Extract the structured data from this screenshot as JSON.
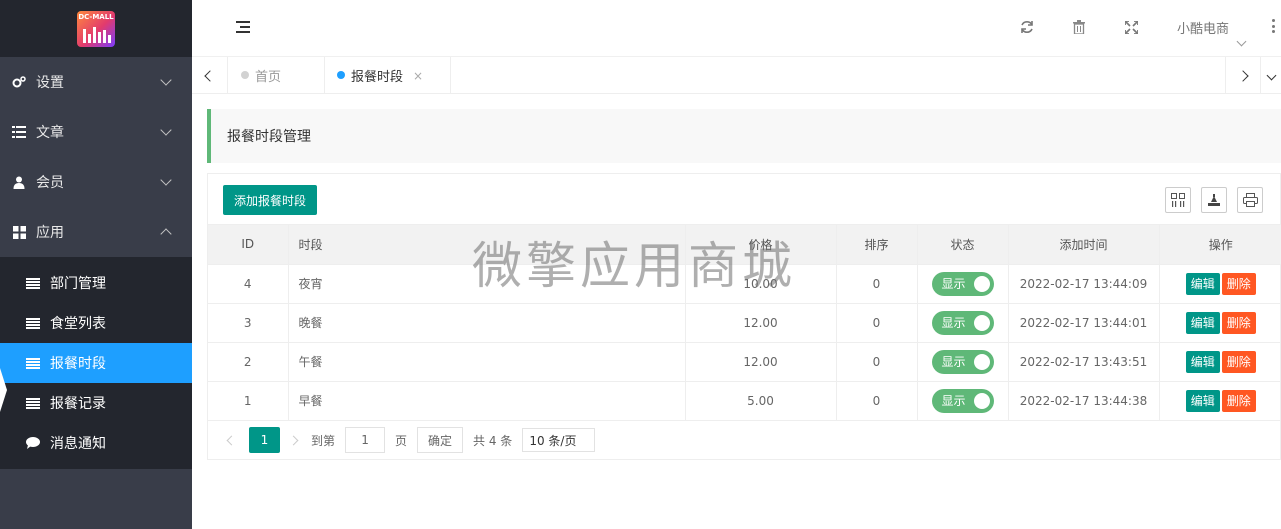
{
  "logo": {
    "text": "DC-MALL"
  },
  "sidebar": {
    "menus": [
      {
        "label": "设置",
        "icon": "gears-icon",
        "expanded": false
      },
      {
        "label": "文章",
        "icon": "list-icon",
        "expanded": false
      },
      {
        "label": "会员",
        "icon": "user-icon",
        "expanded": false
      },
      {
        "label": "应用",
        "icon": "grid-icon",
        "expanded": true
      }
    ],
    "submenu": [
      {
        "label": "部门管理",
        "icon": "list-icon",
        "active": false
      },
      {
        "label": "食堂列表",
        "icon": "list-icon",
        "active": false
      },
      {
        "label": "报餐时段",
        "icon": "list-icon",
        "active": true
      },
      {
        "label": "报餐记录",
        "icon": "list-icon",
        "active": false
      },
      {
        "label": "消息通知",
        "icon": "chat-icon",
        "active": false
      }
    ]
  },
  "header": {
    "user": "小酷电商",
    "icons": [
      "refresh-icon",
      "trash-icon",
      "fullscreen-icon",
      "more-icon"
    ]
  },
  "tabs": [
    {
      "label": "首页",
      "active": false
    },
    {
      "label": "报餐时段",
      "active": true,
      "close": "×"
    }
  ],
  "page": {
    "title": "报餐时段管理"
  },
  "toolbar": {
    "add_label": "添加报餐时段"
  },
  "table": {
    "columns": [
      "ID",
      "时段",
      "价格",
      "排序",
      "状态",
      "添加时间",
      "操作"
    ],
    "rows": [
      {
        "id": "4",
        "period": "夜宵",
        "price": "10.00",
        "sort": "0",
        "status": "显示",
        "time": "2022-02-17 13:44:09"
      },
      {
        "id": "3",
        "period": "晚餐",
        "price": "12.00",
        "sort": "0",
        "status": "显示",
        "time": "2022-02-17 13:44:01"
      },
      {
        "id": "2",
        "period": "午餐",
        "price": "12.00",
        "sort": "0",
        "status": "显示",
        "time": "2022-02-17 13:43:51"
      },
      {
        "id": "1",
        "period": "早餐",
        "price": "5.00",
        "sort": "0",
        "status": "显示",
        "time": "2022-02-17 13:44:38"
      }
    ],
    "edit_label": "编辑",
    "delete_label": "删除"
  },
  "pager": {
    "current": "1",
    "goto_label": "到第",
    "goto_value": "1",
    "page_unit": "页",
    "confirm": "确定",
    "total": "共 4 条",
    "per_page": "10 条/页"
  },
  "watermark": "微擎应用商城",
  "colors": {
    "sidebar": "#393d49",
    "active": "#1e9fff",
    "primary": "#009688",
    "danger": "#ff5722",
    "toggle": "#5fb878"
  }
}
